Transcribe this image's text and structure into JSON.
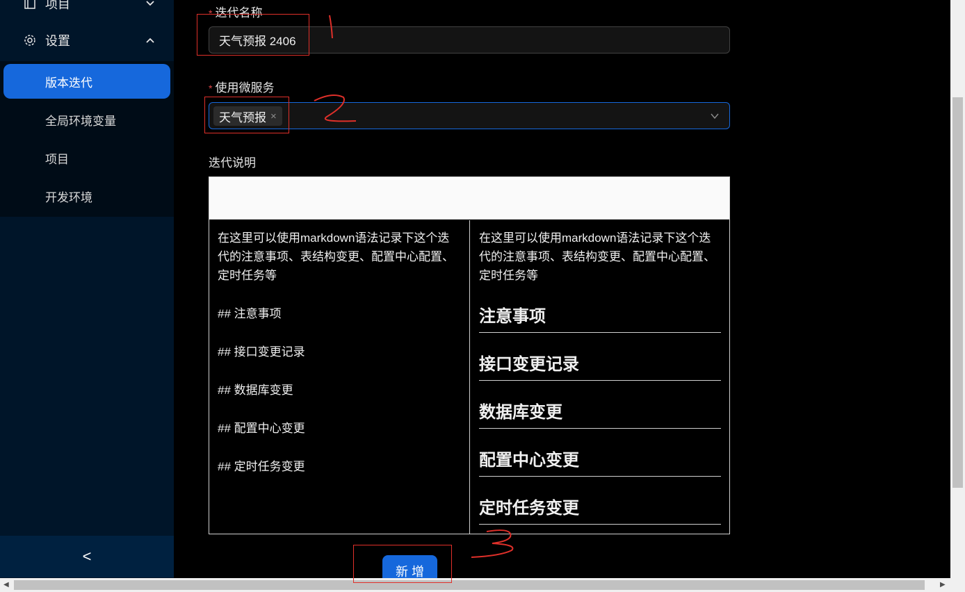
{
  "sidebar": {
    "top_item": {
      "label": "项目",
      "icon": "project-icon"
    },
    "settings": {
      "label": "设置",
      "icon": "gear-icon"
    },
    "sub_items": [
      {
        "label": "版本迭代",
        "active": true
      },
      {
        "label": "全局环境变量",
        "active": false
      },
      {
        "label": "项目",
        "active": false
      },
      {
        "label": "开发环境",
        "active": false
      }
    ],
    "collapse_symbol": "<"
  },
  "form": {
    "iteration_name": {
      "label": "迭代名称",
      "required_mark": "*",
      "value": "天气预报 2406"
    },
    "microservices": {
      "label": "使用微服务",
      "required_mark": "*",
      "tag": "天气预报",
      "tag_close": "×"
    },
    "description": {
      "label": "迭代说明",
      "source_intro": "在这里可以使用markdown语法记录下这个迭代的注意事项、表结构变更、配置中心配置、定时任务等",
      "source_lines": [
        "## 注意事项",
        "## 接口变更记录",
        "## 数据库变更",
        "## 配置中心变更",
        "## 定时任务变更"
      ],
      "preview_intro": "在这里可以使用markdown语法记录下这个迭代的注意事项、表结构变更、配置中心配置、定时任务等",
      "preview_headings": [
        "注意事项",
        "接口变更记录",
        "数据库变更",
        "配置中心变更",
        "定时任务变更"
      ]
    },
    "submit_label": "新 增"
  },
  "annotations": [
    "1",
    "2",
    "3"
  ],
  "colors": {
    "accent": "#1668dc",
    "sidebar": "#001529",
    "annotation": "#e0302a"
  }
}
